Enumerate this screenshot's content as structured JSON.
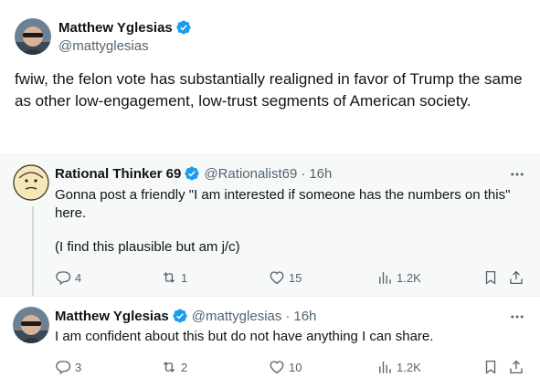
{
  "main_tweet": {
    "display_name": "Matthew Yglesias",
    "handle": "@mattyglesias",
    "text": "fwiw, the felon vote has substantially realigned in favor of Trump the same as other low-engagement, low-trust segments of American society."
  },
  "replies": [
    {
      "display_name": "Rational Thinker 69",
      "handle": "@Rationalist69",
      "separator": "·",
      "time": "16h",
      "text_line1": "Gonna post a friendly \"I am interested if someone has the numbers on this\" here.",
      "text_line2": "(I find this plausible but am j/c)",
      "replies_count": "4",
      "retweets_count": "1",
      "likes_count": "15",
      "views_count": "1.2K"
    },
    {
      "display_name": "Matthew Yglesias",
      "handle": "@mattyglesias",
      "separator": "·",
      "time": "16h",
      "text_line1": "I am confident about this but do not have anything I can share.",
      "replies_count": "3",
      "retweets_count": "2",
      "likes_count": "10",
      "views_count": "1.2K"
    }
  ],
  "colors": {
    "verified": "#1d9bf0",
    "text_primary": "#0f1419",
    "text_secondary": "#536471",
    "highlight_bg": "#f7f9f9"
  }
}
